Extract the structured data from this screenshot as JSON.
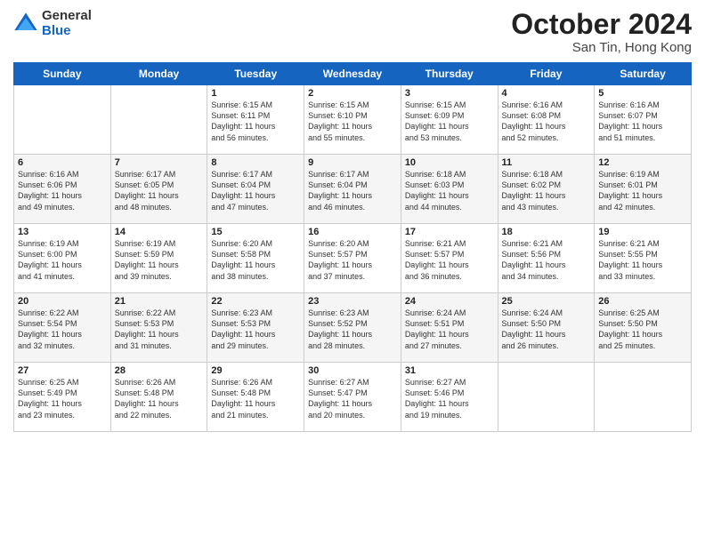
{
  "logo": {
    "general": "General",
    "blue": "Blue"
  },
  "title": "October 2024",
  "location": "San Tin, Hong Kong",
  "days_of_week": [
    "Sunday",
    "Monday",
    "Tuesday",
    "Wednesday",
    "Thursday",
    "Friday",
    "Saturday"
  ],
  "weeks": [
    [
      {
        "day": "",
        "info": ""
      },
      {
        "day": "",
        "info": ""
      },
      {
        "day": "1",
        "info": "Sunrise: 6:15 AM\nSunset: 6:11 PM\nDaylight: 11 hours\nand 56 minutes."
      },
      {
        "day": "2",
        "info": "Sunrise: 6:15 AM\nSunset: 6:10 PM\nDaylight: 11 hours\nand 55 minutes."
      },
      {
        "day": "3",
        "info": "Sunrise: 6:15 AM\nSunset: 6:09 PM\nDaylight: 11 hours\nand 53 minutes."
      },
      {
        "day": "4",
        "info": "Sunrise: 6:16 AM\nSunset: 6:08 PM\nDaylight: 11 hours\nand 52 minutes."
      },
      {
        "day": "5",
        "info": "Sunrise: 6:16 AM\nSunset: 6:07 PM\nDaylight: 11 hours\nand 51 minutes."
      }
    ],
    [
      {
        "day": "6",
        "info": "Sunrise: 6:16 AM\nSunset: 6:06 PM\nDaylight: 11 hours\nand 49 minutes."
      },
      {
        "day": "7",
        "info": "Sunrise: 6:17 AM\nSunset: 6:05 PM\nDaylight: 11 hours\nand 48 minutes."
      },
      {
        "day": "8",
        "info": "Sunrise: 6:17 AM\nSunset: 6:04 PM\nDaylight: 11 hours\nand 47 minutes."
      },
      {
        "day": "9",
        "info": "Sunrise: 6:17 AM\nSunset: 6:04 PM\nDaylight: 11 hours\nand 46 minutes."
      },
      {
        "day": "10",
        "info": "Sunrise: 6:18 AM\nSunset: 6:03 PM\nDaylight: 11 hours\nand 44 minutes."
      },
      {
        "day": "11",
        "info": "Sunrise: 6:18 AM\nSunset: 6:02 PM\nDaylight: 11 hours\nand 43 minutes."
      },
      {
        "day": "12",
        "info": "Sunrise: 6:19 AM\nSunset: 6:01 PM\nDaylight: 11 hours\nand 42 minutes."
      }
    ],
    [
      {
        "day": "13",
        "info": "Sunrise: 6:19 AM\nSunset: 6:00 PM\nDaylight: 11 hours\nand 41 minutes."
      },
      {
        "day": "14",
        "info": "Sunrise: 6:19 AM\nSunset: 5:59 PM\nDaylight: 11 hours\nand 39 minutes."
      },
      {
        "day": "15",
        "info": "Sunrise: 6:20 AM\nSunset: 5:58 PM\nDaylight: 11 hours\nand 38 minutes."
      },
      {
        "day": "16",
        "info": "Sunrise: 6:20 AM\nSunset: 5:57 PM\nDaylight: 11 hours\nand 37 minutes."
      },
      {
        "day": "17",
        "info": "Sunrise: 6:21 AM\nSunset: 5:57 PM\nDaylight: 11 hours\nand 36 minutes."
      },
      {
        "day": "18",
        "info": "Sunrise: 6:21 AM\nSunset: 5:56 PM\nDaylight: 11 hours\nand 34 minutes."
      },
      {
        "day": "19",
        "info": "Sunrise: 6:21 AM\nSunset: 5:55 PM\nDaylight: 11 hours\nand 33 minutes."
      }
    ],
    [
      {
        "day": "20",
        "info": "Sunrise: 6:22 AM\nSunset: 5:54 PM\nDaylight: 11 hours\nand 32 minutes."
      },
      {
        "day": "21",
        "info": "Sunrise: 6:22 AM\nSunset: 5:53 PM\nDaylight: 11 hours\nand 31 minutes."
      },
      {
        "day": "22",
        "info": "Sunrise: 6:23 AM\nSunset: 5:53 PM\nDaylight: 11 hours\nand 29 minutes."
      },
      {
        "day": "23",
        "info": "Sunrise: 6:23 AM\nSunset: 5:52 PM\nDaylight: 11 hours\nand 28 minutes."
      },
      {
        "day": "24",
        "info": "Sunrise: 6:24 AM\nSunset: 5:51 PM\nDaylight: 11 hours\nand 27 minutes."
      },
      {
        "day": "25",
        "info": "Sunrise: 6:24 AM\nSunset: 5:50 PM\nDaylight: 11 hours\nand 26 minutes."
      },
      {
        "day": "26",
        "info": "Sunrise: 6:25 AM\nSunset: 5:50 PM\nDaylight: 11 hours\nand 25 minutes."
      }
    ],
    [
      {
        "day": "27",
        "info": "Sunrise: 6:25 AM\nSunset: 5:49 PM\nDaylight: 11 hours\nand 23 minutes."
      },
      {
        "day": "28",
        "info": "Sunrise: 6:26 AM\nSunset: 5:48 PM\nDaylight: 11 hours\nand 22 minutes."
      },
      {
        "day": "29",
        "info": "Sunrise: 6:26 AM\nSunset: 5:48 PM\nDaylight: 11 hours\nand 21 minutes."
      },
      {
        "day": "30",
        "info": "Sunrise: 6:27 AM\nSunset: 5:47 PM\nDaylight: 11 hours\nand 20 minutes."
      },
      {
        "day": "31",
        "info": "Sunrise: 6:27 AM\nSunset: 5:46 PM\nDaylight: 11 hours\nand 19 minutes."
      },
      {
        "day": "",
        "info": ""
      },
      {
        "day": "",
        "info": ""
      }
    ]
  ]
}
